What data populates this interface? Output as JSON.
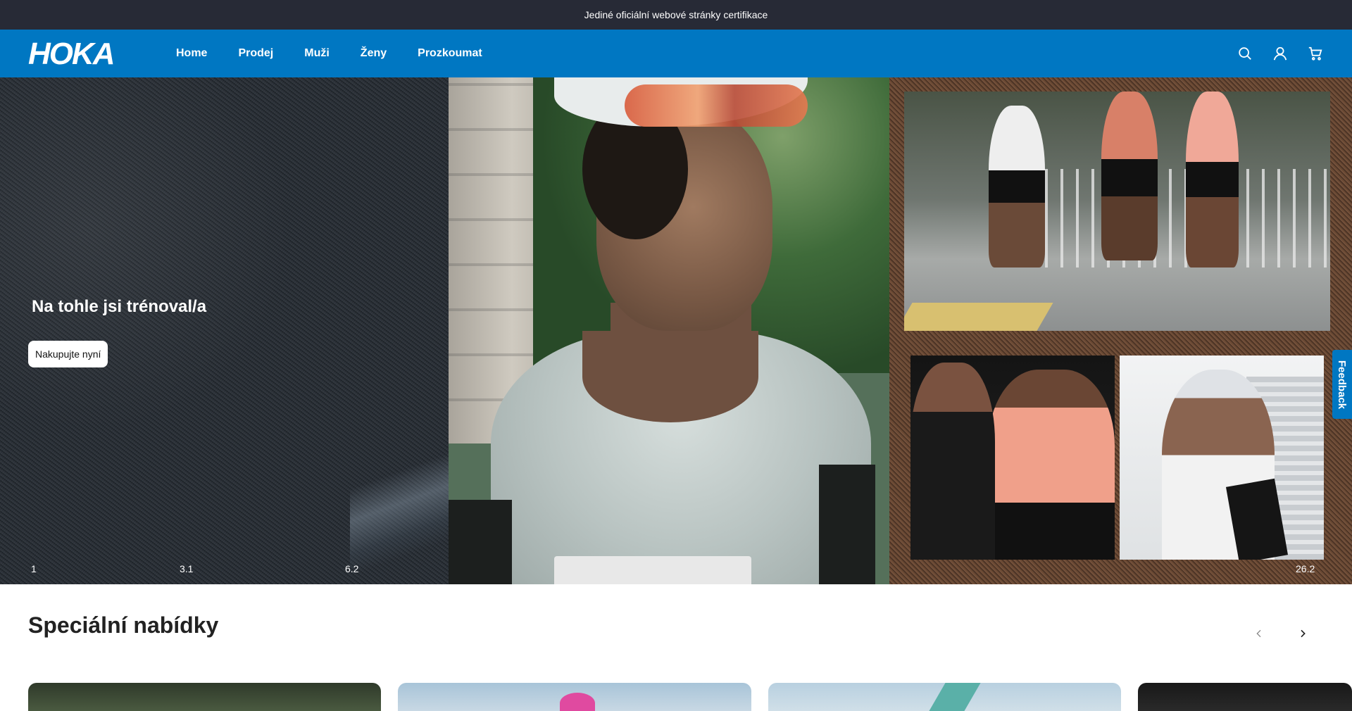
{
  "topbar": {
    "text": "Jediné oficiální webové stránky certifikace"
  },
  "header": {
    "logo_text": "HOKA",
    "nav": [
      "Home",
      "Prodej",
      "Muži",
      "Ženy",
      "Prozkoumat"
    ],
    "icons": [
      "search-icon",
      "account-icon",
      "cart-icon"
    ]
  },
  "hero": {
    "title": "Na tohle jsi trénoval/a",
    "cta": "Nakupujte nyní",
    "distances": [
      "1",
      "3.1",
      "6.2",
      "26.2"
    ]
  },
  "feedback": {
    "label": "Feedback"
  },
  "offers": {
    "title": "Speciální nabídky"
  },
  "colors": {
    "topbar": "#272a36",
    "nav": "#0077c2",
    "white": "#ffffff"
  }
}
